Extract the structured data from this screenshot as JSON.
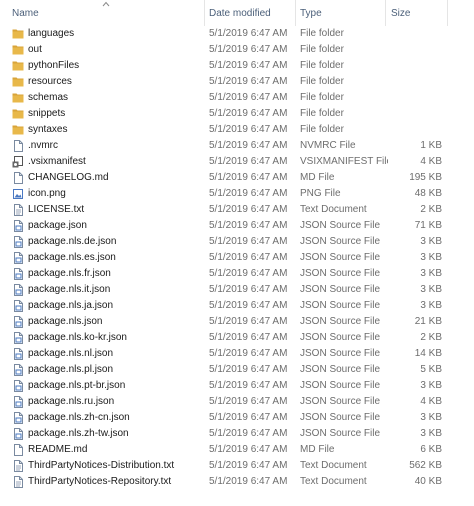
{
  "columns": {
    "name": "Name",
    "date_modified": "Date modified",
    "type": "Type",
    "size": "Size"
  },
  "icon_colors": {
    "folder": "#e8b84a",
    "folder_tab": "#d9a43a",
    "document_border": "#7a8aa0",
    "json_accent": "#4a78c2"
  },
  "files": [
    {
      "name": "languages",
      "date": "5/1/2019 6:47 AM",
      "type": "File folder",
      "size": "",
      "icon": "folder"
    },
    {
      "name": "out",
      "date": "5/1/2019 6:47 AM",
      "type": "File folder",
      "size": "",
      "icon": "folder"
    },
    {
      "name": "pythonFiles",
      "date": "5/1/2019 6:47 AM",
      "type": "File folder",
      "size": "",
      "icon": "folder"
    },
    {
      "name": "resources",
      "date": "5/1/2019 6:47 AM",
      "type": "File folder",
      "size": "",
      "icon": "folder"
    },
    {
      "name": "schemas",
      "date": "5/1/2019 6:47 AM",
      "type": "File folder",
      "size": "",
      "icon": "folder"
    },
    {
      "name": "snippets",
      "date": "5/1/2019 6:47 AM",
      "type": "File folder",
      "size": "",
      "icon": "folder"
    },
    {
      "name": "syntaxes",
      "date": "5/1/2019 6:47 AM",
      "type": "File folder",
      "size": "",
      "icon": "folder"
    },
    {
      "name": ".nvmrc",
      "date": "5/1/2019 6:47 AM",
      "type": "NVMRC File",
      "size": "1 KB",
      "icon": "file"
    },
    {
      "name": ".vsixmanifest",
      "date": "5/1/2019 6:47 AM",
      "type": "VSIXMANIFEST File",
      "size": "4 KB",
      "icon": "manifest"
    },
    {
      "name": "CHANGELOG.md",
      "date": "5/1/2019 6:47 AM",
      "type": "MD File",
      "size": "195 KB",
      "icon": "file"
    },
    {
      "name": "icon.png",
      "date": "5/1/2019 6:47 AM",
      "type": "PNG File",
      "size": "48 KB",
      "icon": "image"
    },
    {
      "name": "LICENSE.txt",
      "date": "5/1/2019 6:47 AM",
      "type": "Text Document",
      "size": "2 KB",
      "icon": "text"
    },
    {
      "name": "package.json",
      "date": "5/1/2019 6:47 AM",
      "type": "JSON Source File",
      "size": "71 KB",
      "icon": "json"
    },
    {
      "name": "package.nls.de.json",
      "date": "5/1/2019 6:47 AM",
      "type": "JSON Source File",
      "size": "3 KB",
      "icon": "json"
    },
    {
      "name": "package.nls.es.json",
      "date": "5/1/2019 6:47 AM",
      "type": "JSON Source File",
      "size": "3 KB",
      "icon": "json"
    },
    {
      "name": "package.nls.fr.json",
      "date": "5/1/2019 6:47 AM",
      "type": "JSON Source File",
      "size": "3 KB",
      "icon": "json"
    },
    {
      "name": "package.nls.it.json",
      "date": "5/1/2019 6:47 AM",
      "type": "JSON Source File",
      "size": "3 KB",
      "icon": "json"
    },
    {
      "name": "package.nls.ja.json",
      "date": "5/1/2019 6:47 AM",
      "type": "JSON Source File",
      "size": "3 KB",
      "icon": "json"
    },
    {
      "name": "package.nls.json",
      "date": "5/1/2019 6:47 AM",
      "type": "JSON Source File",
      "size": "21 KB",
      "icon": "json"
    },
    {
      "name": "package.nls.ko-kr.json",
      "date": "5/1/2019 6:47 AM",
      "type": "JSON Source File",
      "size": "2 KB",
      "icon": "json"
    },
    {
      "name": "package.nls.nl.json",
      "date": "5/1/2019 6:47 AM",
      "type": "JSON Source File",
      "size": "14 KB",
      "icon": "json"
    },
    {
      "name": "package.nls.pl.json",
      "date": "5/1/2019 6:47 AM",
      "type": "JSON Source File",
      "size": "5 KB",
      "icon": "json"
    },
    {
      "name": "package.nls.pt-br.json",
      "date": "5/1/2019 6:47 AM",
      "type": "JSON Source File",
      "size": "3 KB",
      "icon": "json"
    },
    {
      "name": "package.nls.ru.json",
      "date": "5/1/2019 6:47 AM",
      "type": "JSON Source File",
      "size": "4 KB",
      "icon": "json"
    },
    {
      "name": "package.nls.zh-cn.json",
      "date": "5/1/2019 6:47 AM",
      "type": "JSON Source File",
      "size": "3 KB",
      "icon": "json"
    },
    {
      "name": "package.nls.zh-tw.json",
      "date": "5/1/2019 6:47 AM",
      "type": "JSON Source File",
      "size": "3 KB",
      "icon": "json"
    },
    {
      "name": "README.md",
      "date": "5/1/2019 6:47 AM",
      "type": "MD File",
      "size": "6 KB",
      "icon": "file"
    },
    {
      "name": "ThirdPartyNotices-Distribution.txt",
      "date": "5/1/2019 6:47 AM",
      "type": "Text Document",
      "size": "562 KB",
      "icon": "text"
    },
    {
      "name": "ThirdPartyNotices-Repository.txt",
      "date": "5/1/2019 6:47 AM",
      "type": "Text Document",
      "size": "40 KB",
      "icon": "text"
    }
  ]
}
